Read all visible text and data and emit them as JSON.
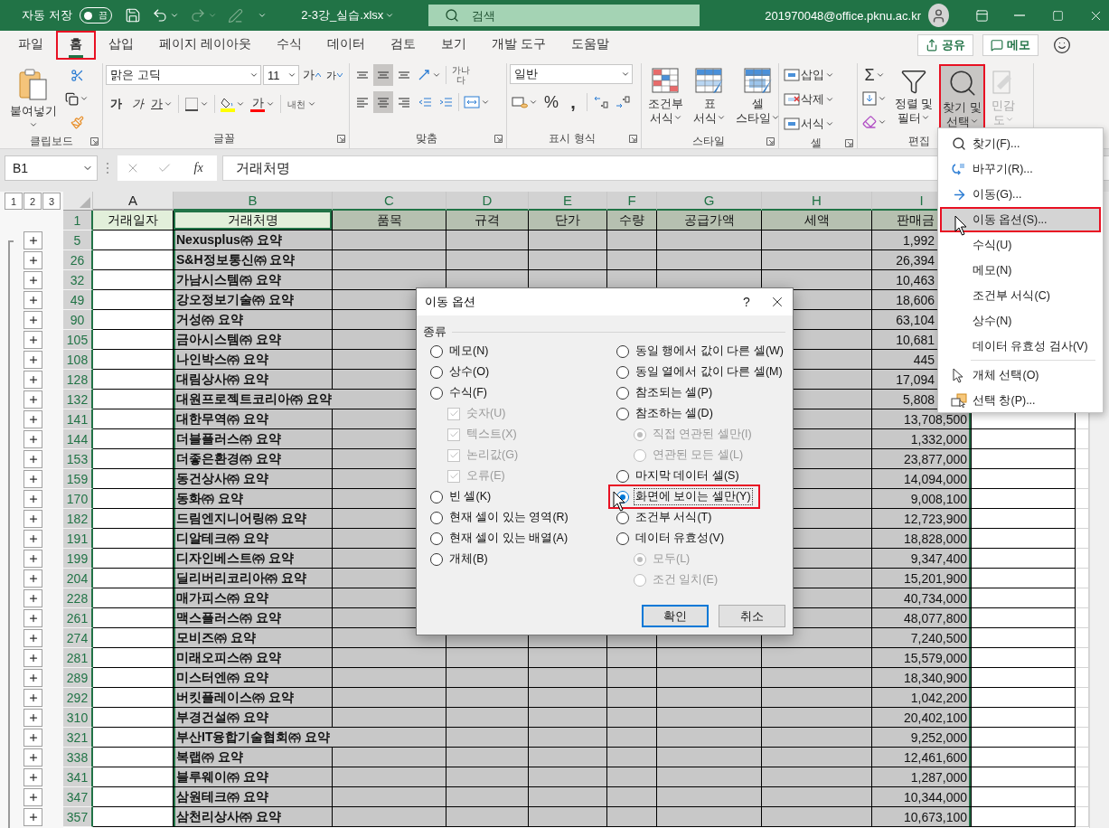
{
  "titlebar": {
    "autosave_label": "자동 저장",
    "autosave_state": "끔",
    "autosave_on": false,
    "filename": "2-3강_실습.xlsx",
    "search_placeholder": "검색",
    "account": "201970048@office.pknu.ac.kr"
  },
  "tabs": [
    {
      "label": "파일",
      "selected": false,
      "highlighted": false
    },
    {
      "label": "홈",
      "selected": true,
      "highlighted": true
    },
    {
      "label": "삽입",
      "selected": false,
      "highlighted": false
    },
    {
      "label": "페이지 레이아웃",
      "selected": false,
      "highlighted": false
    },
    {
      "label": "수식",
      "selected": false,
      "highlighted": false
    },
    {
      "label": "데이터",
      "selected": false,
      "highlighted": false
    },
    {
      "label": "검토",
      "selected": false,
      "highlighted": false
    },
    {
      "label": "보기",
      "selected": false,
      "highlighted": false
    },
    {
      "label": "개발 도구",
      "selected": false,
      "highlighted": false
    },
    {
      "label": "도움말",
      "selected": false,
      "highlighted": false
    }
  ],
  "actions": {
    "share": "공유",
    "comments": "메모"
  },
  "ribbon": {
    "clipboard": {
      "label": "클립보드",
      "paste": "붙여넣기"
    },
    "font": {
      "label": "글꼴",
      "name": "맑은 고딕",
      "size": "11",
      "grow": "가",
      "shrink": "가",
      "bold": "가",
      "italic": "가",
      "underline": "가",
      "color_letter": "가",
      "phonetic": "내천"
    },
    "alignment": {
      "label": "맞춤",
      "wrap": "가나다",
      "vertical": [
        {
          "pressed": false
        },
        {
          "pressed": true
        },
        {
          "pressed": false
        }
      ],
      "horizontal": [
        {
          "pressed": false
        },
        {
          "pressed": true
        },
        {
          "pressed": false
        }
      ]
    },
    "number": {
      "label": "표시 형식",
      "format": "일반",
      "percent": "%",
      "comma": ","
    },
    "styles": {
      "label": "스타일",
      "buttons": [
        "조건부\n서식",
        "표\n서식",
        "셀\n스타일"
      ]
    },
    "cells": {
      "label": "셀",
      "buttons": [
        "삽입",
        "삭제",
        "서식"
      ]
    },
    "editing": {
      "label": "편집",
      "sum": "Σ",
      "sort": "정렬 및\n필터",
      "find": "찾기 및\n선택",
      "find_highlighted": true
    },
    "sensitivity": {
      "label": "민감\n도",
      "disabled": true
    }
  },
  "formula_bar": {
    "name_box": "B1",
    "fx": "fx",
    "value": "거래처명"
  },
  "sheet": {
    "outline_levels": [
      "1",
      "2",
      "3"
    ],
    "columns": [
      {
        "letter": "A",
        "selected": false,
        "active": false
      },
      {
        "letter": "B",
        "selected": true,
        "active": true
      },
      {
        "letter": "C",
        "selected": true,
        "active": false
      },
      {
        "letter": "D",
        "selected": true,
        "active": false
      },
      {
        "letter": "E",
        "selected": true,
        "active": false
      },
      {
        "letter": "F",
        "selected": true,
        "active": false
      },
      {
        "letter": "G",
        "selected": true,
        "active": false
      },
      {
        "letter": "H",
        "selected": true,
        "active": false
      },
      {
        "letter": "I",
        "selected": true,
        "active": false
      }
    ],
    "header_row": {
      "number": "1",
      "selected": true,
      "cells": [
        "거래일자",
        "거래처명",
        "품목",
        "규격",
        "단가",
        "수량",
        "공급가액",
        "세액",
        "판매금"
      ]
    },
    "rows": [
      {
        "number": "5",
        "selected": true,
        "collapsed": true,
        "name": "Nexusplus㈜ 요약",
        "amount": "1,992",
        "clipped": true
      },
      {
        "number": "26",
        "selected": true,
        "collapsed": true,
        "name": "S&H정보통신㈜ 요약",
        "amount": "26,394",
        "clipped": true
      },
      {
        "number": "32",
        "selected": true,
        "collapsed": true,
        "name": "가남시스템㈜ 요약",
        "amount": "10,463",
        "clipped": true
      },
      {
        "number": "49",
        "selected": true,
        "collapsed": true,
        "name": "강오정보기술㈜ 요약",
        "amount": "18,606",
        "clipped": true
      },
      {
        "number": "90",
        "selected": true,
        "collapsed": true,
        "name": "거성㈜ 요약",
        "amount": "63,104",
        "clipped": true
      },
      {
        "number": "105",
        "selected": true,
        "collapsed": true,
        "name": "금아시스템㈜ 요약",
        "amount": "10,681",
        "clipped": true
      },
      {
        "number": "108",
        "selected": true,
        "collapsed": true,
        "name": "나인박스㈜ 요약",
        "amount": "445",
        "clipped": true
      },
      {
        "number": "128",
        "selected": true,
        "collapsed": true,
        "name": "대림상사㈜ 요약",
        "amount": "17,094",
        "clipped": true
      },
      {
        "number": "132",
        "selected": true,
        "collapsed": true,
        "name": "대원프로젝트코리아㈜ 요약",
        "amount": "5,808",
        "clipped": true,
        "overflow": true
      },
      {
        "number": "141",
        "selected": true,
        "collapsed": true,
        "name": "대한무역㈜ 요약",
        "amount": "13,708,500"
      },
      {
        "number": "144",
        "selected": true,
        "collapsed": true,
        "name": "더블플러스㈜ 요약",
        "amount": "1,332,000"
      },
      {
        "number": "153",
        "selected": true,
        "collapsed": true,
        "name": "더좋은환경㈜ 요약",
        "amount": "23,877,000"
      },
      {
        "number": "159",
        "selected": true,
        "collapsed": true,
        "name": "동건상사㈜ 요약",
        "amount": "14,094,000"
      },
      {
        "number": "170",
        "selected": true,
        "collapsed": true,
        "name": "동화㈜ 요약",
        "amount": "9,008,100"
      },
      {
        "number": "182",
        "selected": true,
        "collapsed": true,
        "name": "드림엔지니어링㈜ 요약",
        "amount": "12,723,900"
      },
      {
        "number": "191",
        "selected": true,
        "collapsed": true,
        "name": "디알테크㈜ 요약",
        "amount": "18,828,000"
      },
      {
        "number": "199",
        "selected": true,
        "collapsed": true,
        "name": "디자인베스트㈜ 요약",
        "amount": "9,347,400"
      },
      {
        "number": "204",
        "selected": true,
        "collapsed": true,
        "name": "딜리버리코리아㈜ 요약",
        "amount": "15,201,900"
      },
      {
        "number": "228",
        "selected": true,
        "collapsed": true,
        "name": "매가피스㈜ 요약",
        "amount": "40,734,000"
      },
      {
        "number": "261",
        "selected": true,
        "collapsed": true,
        "name": "맥스플러스㈜ 요약",
        "amount": "48,077,800"
      },
      {
        "number": "274",
        "selected": true,
        "collapsed": true,
        "name": "모비즈㈜ 요약",
        "amount": "7,240,500"
      },
      {
        "number": "281",
        "selected": true,
        "collapsed": true,
        "name": "미래오피스㈜ 요약",
        "amount": "15,579,000"
      },
      {
        "number": "289",
        "selected": true,
        "collapsed": true,
        "name": "미스터엔㈜ 요약",
        "amount": "18,340,900"
      },
      {
        "number": "292",
        "selected": true,
        "collapsed": true,
        "name": "버킷플레이스㈜ 요약",
        "amount": "1,042,200"
      },
      {
        "number": "310",
        "selected": true,
        "collapsed": true,
        "name": "부경건설㈜ 요약",
        "amount": "20,402,100"
      },
      {
        "number": "321",
        "selected": true,
        "collapsed": true,
        "name": "부산IT융합기술협회㈜ 요약",
        "amount": "9,252,000",
        "overflow": true
      },
      {
        "number": "338",
        "selected": true,
        "collapsed": true,
        "name": "복랩㈜ 요약",
        "amount": "12,461,600"
      },
      {
        "number": "341",
        "selected": true,
        "collapsed": true,
        "name": "블루웨이㈜ 요약",
        "amount": "1,287,000"
      },
      {
        "number": "347",
        "selected": true,
        "collapsed": true,
        "name": "삼원테크㈜ 요약",
        "amount": "10,344,000"
      },
      {
        "number": "357",
        "selected": true,
        "collapsed": true,
        "name": "삼천리상사㈜ 요약",
        "amount": "10,673,100"
      }
    ]
  },
  "dialog": {
    "title": "이동 옵션",
    "help": "?",
    "group_label": "종류",
    "columns": [
      {
        "options": [
          {
            "label": "메모(N)",
            "kind": "radio",
            "selected": false
          },
          {
            "label": "상수(O)",
            "kind": "radio",
            "selected": false
          },
          {
            "label": "수식(F)",
            "kind": "radio",
            "selected": false,
            "children": [
              {
                "label": "숫자(U)",
                "kind": "check",
                "checked": true,
                "disabled": true
              },
              {
                "label": "텍스트(X)",
                "kind": "check",
                "checked": true,
                "disabled": true
              },
              {
                "label": "논리값(G)",
                "kind": "check",
                "checked": true,
                "disabled": true
              },
              {
                "label": "오류(E)",
                "kind": "check",
                "checked": true,
                "disabled": true
              }
            ]
          },
          {
            "label": "빈 셀(K)",
            "kind": "radio",
            "selected": false
          },
          {
            "label": "현재 셀이 있는 영역(R)",
            "kind": "radio",
            "selected": false
          },
          {
            "label": "현재 셀이 있는 배열(A)",
            "kind": "radio",
            "selected": false
          },
          {
            "label": "개체(B)",
            "kind": "radio",
            "selected": false
          }
        ]
      },
      {
        "options": [
          {
            "label": "동일 행에서 값이 다른 셀(W)",
            "kind": "radio",
            "selected": false
          },
          {
            "label": "동일 열에서 값이 다른 셀(M)",
            "kind": "radio",
            "selected": false
          },
          {
            "label": "참조되는 셀(P)",
            "kind": "radio",
            "selected": false
          },
          {
            "label": "참조하는 셀(D)",
            "kind": "radio",
            "selected": false,
            "children": [
              {
                "label": "직접 연관된 셀만(I)",
                "kind": "radio",
                "selected": true,
                "disabled": true
              },
              {
                "label": "연관된 모든 셀(L)",
                "kind": "radio",
                "selected": false,
                "disabled": true
              }
            ]
          },
          {
            "label": "마지막 데이터 셀(S)",
            "kind": "radio",
            "selected": false
          },
          {
            "label": "화면에 보이는 셀만(Y)",
            "kind": "radio",
            "selected": true,
            "highlighted": true
          },
          {
            "label": "조건부 서식(T)",
            "kind": "radio",
            "selected": false
          },
          {
            "label": "데이터 유효성(V)",
            "kind": "radio",
            "selected": false,
            "children": [
              {
                "label": "모두(L)",
                "kind": "radio",
                "selected": true,
                "disabled": true
              },
              {
                "label": "조건 일치(E)",
                "kind": "radio",
                "selected": false,
                "disabled": true
              }
            ]
          }
        ]
      }
    ],
    "buttons": [
      {
        "label": "확인",
        "default": true
      },
      {
        "label": "취소",
        "default": false
      }
    ]
  },
  "menu": {
    "sections": [
      {
        "items": [
          {
            "label": "찾기(F)...",
            "kind": "find",
            "selected": false
          },
          {
            "label": "바꾸기(R)...",
            "kind": "replace",
            "selected": false
          },
          {
            "label": "이동(G)...",
            "kind": "goto",
            "selected": false
          },
          {
            "label": "이동 옵션(S)...",
            "kind": "plain",
            "selected": true,
            "highlighted": true
          },
          {
            "label": "수식(U)",
            "kind": "plain",
            "selected": false
          },
          {
            "label": "메모(N)",
            "kind": "plain",
            "selected": false
          },
          {
            "label": "조건부 서식(C)",
            "kind": "plain",
            "selected": false
          },
          {
            "label": "상수(N)",
            "kind": "plain",
            "selected": false
          },
          {
            "label": "데이터 유효성 검사(V)",
            "kind": "plain",
            "selected": false
          }
        ]
      },
      {
        "items": [
          {
            "label": "개체 선택(O)",
            "kind": "select",
            "selected": false
          },
          {
            "label": "선택 창(P)...",
            "kind": "pane",
            "selected": false
          }
        ]
      }
    ]
  }
}
